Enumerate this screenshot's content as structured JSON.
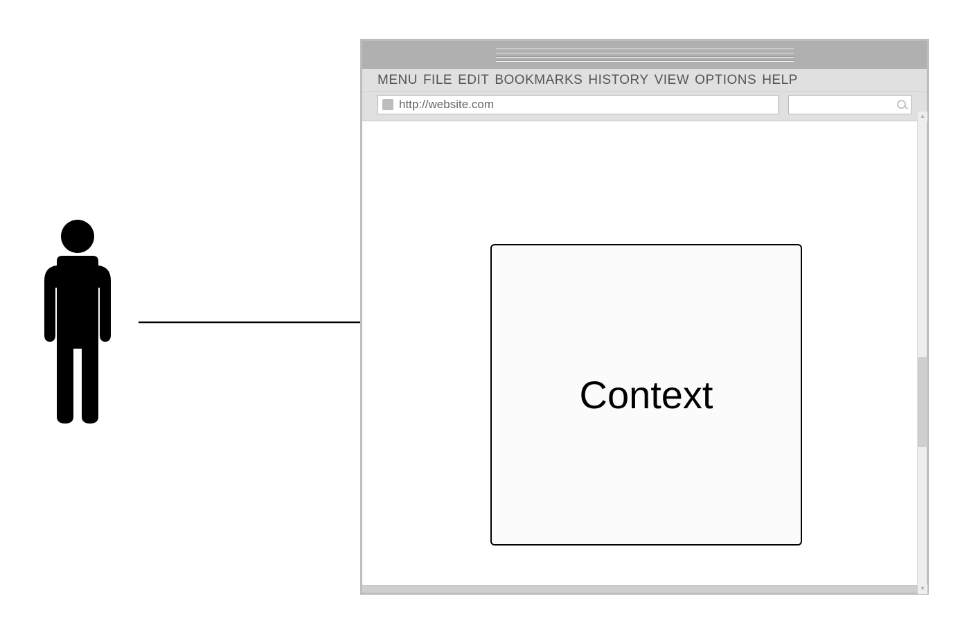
{
  "menu": {
    "items": [
      "MENU",
      "FILE",
      "EDIT",
      "BOOKMARKS",
      "HISTORY",
      "VIEW",
      "OPTIONS",
      "HELP"
    ]
  },
  "address": {
    "url": "http://website.com"
  },
  "content": {
    "context_label": "Context"
  }
}
